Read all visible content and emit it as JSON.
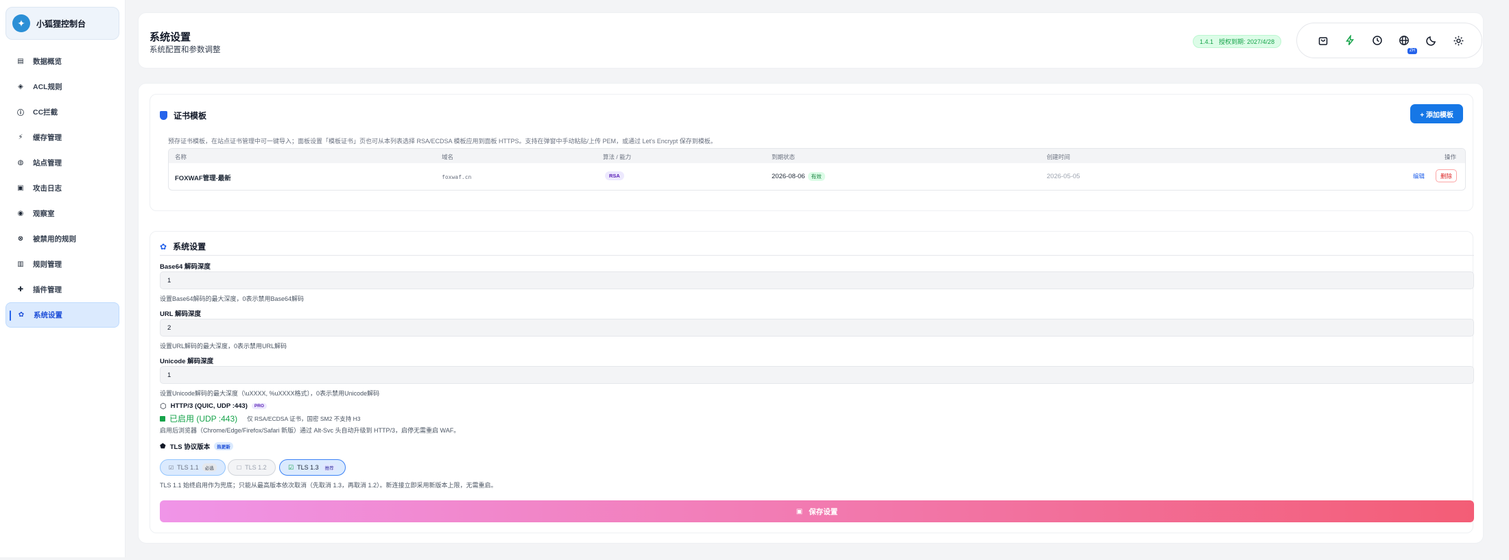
{
  "app": {
    "name": "小狐狸控制台"
  },
  "sidebar": {
    "items": [
      {
        "label": "数据概览",
        "icon": "grid-icon",
        "glyph": "▤"
      },
      {
        "label": "ACL规则",
        "icon": "layers-icon",
        "glyph": "◈"
      },
      {
        "label": "CC拦截",
        "icon": "info-icon",
        "glyph": "ⓘ"
      },
      {
        "label": "缓存管理",
        "icon": "bolt-icon",
        "glyph": "⚡"
      },
      {
        "label": "站点管理",
        "icon": "globe-icon",
        "glyph": "◍"
      },
      {
        "label": "攻击日志",
        "icon": "file-icon",
        "glyph": "▣"
      },
      {
        "label": "观察室",
        "icon": "eye-icon",
        "glyph": "◉"
      },
      {
        "label": "被禁用的规则",
        "icon": "ban-icon",
        "glyph": "⊗"
      },
      {
        "label": "规则管理",
        "icon": "book-icon",
        "glyph": "▥"
      },
      {
        "label": "插件管理",
        "icon": "puzzle-icon",
        "glyph": "✚"
      },
      {
        "label": "系统设置",
        "icon": "gear-icon",
        "glyph": "✿"
      }
    ]
  },
  "header": {
    "title": "系统设置",
    "subtitle": "系统配置和参数调整",
    "version": "1.4.1",
    "license": "授权到期: 2027/4/28",
    "lang_badge": "ZH"
  },
  "cert": {
    "title": "证书模板",
    "add_label": "+ 添加模板",
    "description": "预存证书模板，在站点证书管理中可一键导入；面板设置「模板证书」页也可从本列表选择 RSA/ECDSA 模板应用到面板 HTTPS。支持在弹窗中手动粘贴/上传 PEM，或通过 Let's Encrypt 保存到模板。",
    "columns": [
      "名称",
      "域名",
      "算法 / 能力",
      "到期状态",
      "创建时间",
      "操作"
    ],
    "rows": [
      {
        "name": "FOXWAF管理-最新",
        "domain": "foxwaf.cn",
        "algo": "RSA",
        "expire": "2026-08-06",
        "status": "有效",
        "created": "2026-05-05",
        "edit": "编辑",
        "delete": "删除"
      }
    ]
  },
  "settings": {
    "title": "系统设置",
    "base64": {
      "label": "Base64 解码深度",
      "value": "1",
      "hint": "设置Base64解码的最大深度，0表示禁用Base64解码"
    },
    "url": {
      "label": "URL 解码深度",
      "value": "2",
      "hint": "设置URL解码的最大深度，0表示禁用URL解码"
    },
    "unicode": {
      "label": "Unicode 解码深度",
      "value": "1",
      "hint": "设置Unicode解码的最大深度（\\uXXXX, %uXXXX格式），0表示禁用Unicode解码"
    },
    "http3": {
      "label": "HTTP/3 (QUIC, UDP :443)",
      "badge": "PRO",
      "enabled_text": "已启用 (UDP :443)",
      "enabled_note": "仅 RSA/ECDSA 证书，国密 SM2 不支持 H3",
      "hint": "启用后浏览器（Chrome/Edge/Firefox/Safari 新版）通过 Alt-Svc 头自动升级到 HTTP/3，启停无需重启 WAF。"
    },
    "tls": {
      "label": "TLS 协议版本",
      "badge": "热更新",
      "versions": [
        {
          "label": "TLS 1.1",
          "tag": "必选"
        },
        {
          "label": "TLS 1.2",
          "tag": ""
        },
        {
          "label": "TLS 1.3",
          "tag": "推荐"
        }
      ],
      "hint": "TLS 1.1 始终启用作为兜底；只能从最高版本依次取消（先取消 1.3，再取消 1.2）。新连接立即采用新版本上限，无需重启。"
    },
    "save_label": "保存设置"
  },
  "colors": {
    "accent": "#2563eb",
    "success": "#16a34a",
    "danger": "#dc2626"
  }
}
